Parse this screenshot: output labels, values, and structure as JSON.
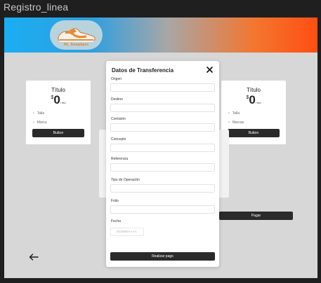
{
  "window": {
    "title": "Registro_linea"
  },
  "logo": {
    "caption": "Hi, Sneakers"
  },
  "plans": [
    {
      "title": "Título",
      "currency": "$",
      "amount": "0",
      "period": "/ mo",
      "features": [
        "Talla",
        "Marca"
      ],
      "button": "Button"
    },
    {
      "title": "Título",
      "currency": "$",
      "amount": "0",
      "period": "/ mo",
      "features": [
        "Talla",
        "Marcas"
      ],
      "button": "Button"
    }
  ],
  "pay_button": "Pagar",
  "modal": {
    "title": "Datos de Transferencia",
    "fields": [
      {
        "label": "Origen",
        "value": ""
      },
      {
        "label": "Destino",
        "value": ""
      },
      {
        "label": "Comisión",
        "value": ""
      },
      {
        "label": "Concepto",
        "value": ""
      },
      {
        "label": "Referencia",
        "value": ""
      },
      {
        "label": "Tipo de Operación",
        "value": ""
      },
      {
        "label": "Folio",
        "value": ""
      }
    ],
    "date": {
      "label": "Fecha",
      "placeholder": "DD/MM/AAAA"
    },
    "submit": "Realizar pago"
  },
  "colors": {
    "button_dark": "#2a2a2a",
    "hero_left": "#1aaef2",
    "hero_right": "#ff4e12",
    "logo_orange": "#e6842e"
  }
}
